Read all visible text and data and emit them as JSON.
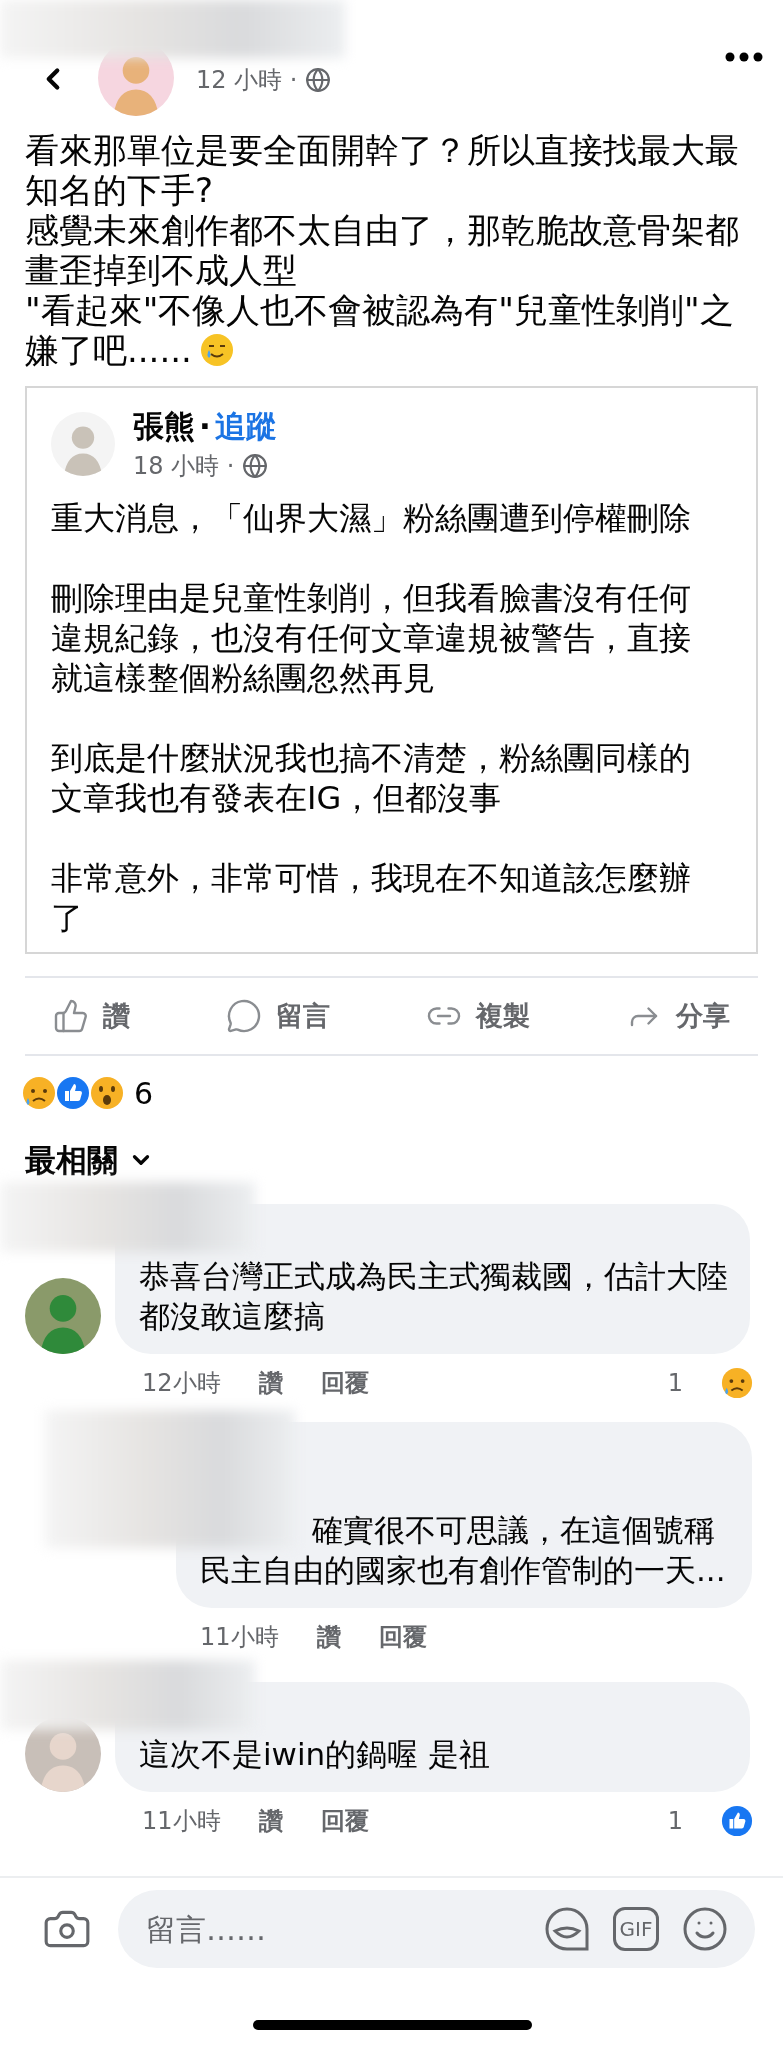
{
  "post": {
    "time": "12 小時 ·",
    "paragraphs": [
      "看來那單位是要全面開幹了？所以直接找最大最知名的下手?",
      "感覺未來創作都不太自由了，那乾脆故意骨架都畫歪掉到不成人型",
      "\"看起來\"不像人也不會被認為有\"兒童性剝削\"之"
    ],
    "last_line": "嫌了吧......"
  },
  "shared_post": {
    "author": "張熊",
    "separator": "·",
    "follow": "追蹤",
    "time": "18 小時 ·",
    "paragraphs": [
      "重大消息，「仙界大濕」粉絲團遭到停權刪除",
      "刪除理由是兒童性剝削，但我看臉書沒有任何違規紀錄，也沒有任何文章違規被警告，直接就這樣整個粉絲團忽然再見",
      "到底是什麼狀況我也搞不清楚，粉絲團同樣的文章我也有發表在IG，但都沒事",
      "非常意外，非常可惜，我現在不知道該怎麼辦了"
    ]
  },
  "actions": [
    {
      "kind": "like",
      "label": "讚"
    },
    {
      "kind": "comment",
      "label": "留言"
    },
    {
      "kind": "copy",
      "label": "複製"
    },
    {
      "kind": "share",
      "label": "分享"
    }
  ],
  "reactions": {
    "count": "6"
  },
  "sort": {
    "label": "最相關"
  },
  "comments": [
    {
      "kind": "top",
      "text": "恭喜台灣正式成為民主式獨裁國，估計大陸都沒敢這麼搞",
      "time": "12小時",
      "like": "讚",
      "reply": "回覆",
      "reaction": {
        "count": "1",
        "kind": "sad"
      }
    },
    {
      "kind": "reply",
      "text": "確實很不可思議，在這個號稱民主自由的國家也有創作管制的一天...",
      "time": "11小時",
      "like": "讚",
      "reply": "回覆"
    },
    {
      "kind": "top",
      "text": "這次不是iwin的鍋喔 是祖",
      "time": "11小時",
      "like": "讚",
      "reply": "回覆",
      "reaction": {
        "count": "1",
        "kind": "like"
      }
    }
  ],
  "composer": {
    "placeholder": "留言……",
    "gif": "GIF"
  }
}
